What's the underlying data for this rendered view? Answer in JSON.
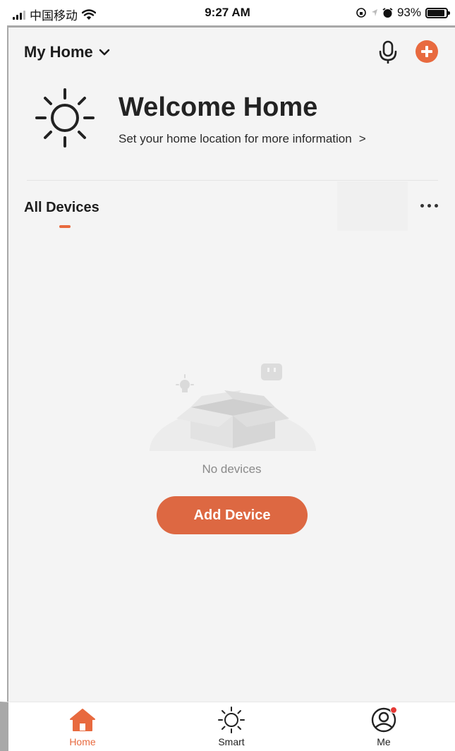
{
  "status_bar": {
    "carrier": "中国移动",
    "time": "9:27 AM",
    "battery": "93%",
    "battery_level": 0.93
  },
  "header": {
    "home_name": "My Home",
    "icons": [
      "chevron-down-icon",
      "microphone-icon",
      "add-circle-icon"
    ]
  },
  "welcome": {
    "title": "Welcome Home",
    "subtitle": "Set your home location for more information",
    "chevron": ">",
    "icon": "sun-icon"
  },
  "devices": {
    "tab_label": "All Devices",
    "more_icon": "more-icon",
    "empty_text": "No devices",
    "add_button": "Add Device",
    "illustration": "empty-box-illustration"
  },
  "tab_bar": {
    "items": [
      {
        "label": "Home",
        "icon": "home-icon",
        "active": true
      },
      {
        "label": "Smart",
        "icon": "sun-icon",
        "active": false
      },
      {
        "label": "Me",
        "icon": "profile-icon",
        "active": false
      }
    ]
  },
  "colors": {
    "accent": "#e86a3f",
    "background": "#f4f4f4",
    "text": "#222222",
    "muted": "#8a8a8a"
  }
}
